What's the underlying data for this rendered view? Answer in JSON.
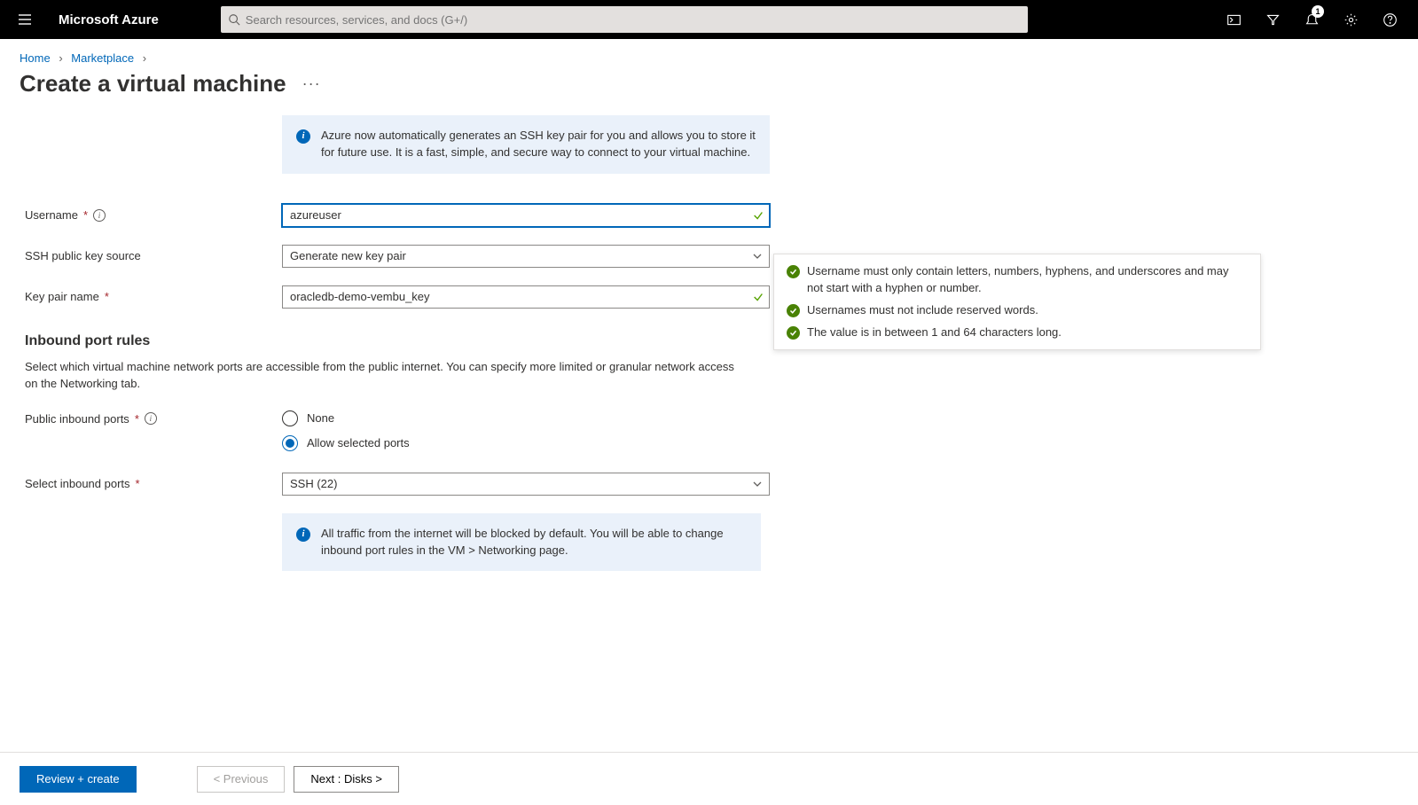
{
  "header": {
    "brand": "Microsoft Azure",
    "search_placeholder": "Search resources, services, and docs (G+/)",
    "notification_count": "1"
  },
  "breadcrumbs": {
    "items": [
      "Home",
      "Marketplace"
    ]
  },
  "page": {
    "title": "Create a virtual machine"
  },
  "info_banner_1": "Azure now automatically generates an SSH key pair for you and allows you to store it for future use. It is a fast, simple, and secure way to connect to your virtual machine.",
  "form": {
    "username_label": "Username",
    "username_value": "azureuser",
    "ssh_source_label": "SSH public key source",
    "ssh_source_value": "Generate new key pair",
    "keypair_label": "Key pair name",
    "keypair_value": "oracledb-demo-vembu_key"
  },
  "inbound": {
    "heading": "Inbound port rules",
    "desc": "Select which virtual machine network ports are accessible from the public internet. You can specify more limited or granular network access on the Networking tab.",
    "public_ports_label": "Public inbound ports",
    "radio_none": "None",
    "radio_allow": "Allow selected ports",
    "select_ports_label": "Select inbound ports",
    "select_ports_value": "SSH (22)"
  },
  "info_banner_2": "All traffic from the internet will be blocked by default. You will be able to change inbound port rules in the VM > Networking page.",
  "validation": {
    "rule1": "Username must only contain letters, numbers, hyphens, and underscores and may not start with a hyphen or number.",
    "rule2": "Usernames must not include reserved words.",
    "rule3": "The value is in between 1 and 64 characters long."
  },
  "footer": {
    "review": "Review + create",
    "prev": "< Previous",
    "next": "Next : Disks >"
  }
}
